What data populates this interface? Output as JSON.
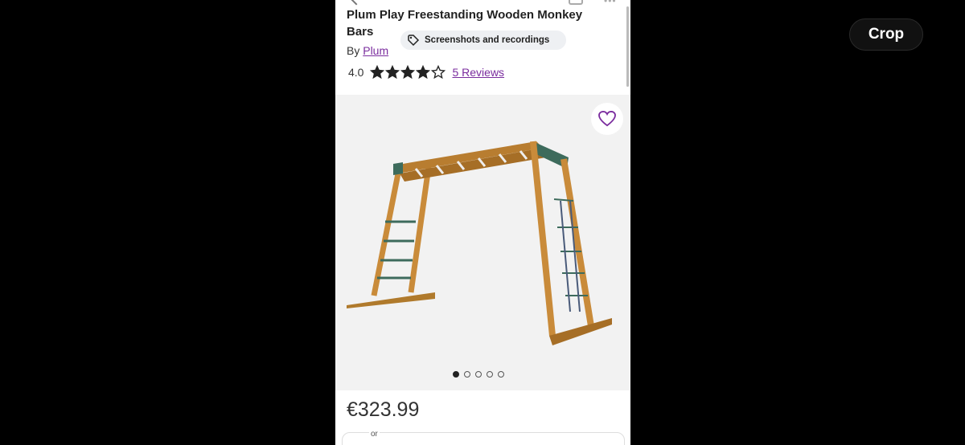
{
  "crop_button": {
    "label": "Crop"
  },
  "product": {
    "title": "Plum Play Freestanding Wooden Monkey Bars",
    "by_prefix": "By",
    "brand": "Plum",
    "rating": "4.0",
    "rating_value": 4,
    "rating_max": 5,
    "reviews_label": "5 Reviews",
    "price": "€323.99",
    "or_label": "or"
  },
  "screenshot_pill": {
    "label": "Screenshots and recordings",
    "icon": "tag-icon"
  },
  "gallery": {
    "image_count": 5,
    "active_index": 0,
    "favorite_icon": "heart-icon"
  },
  "colors": {
    "accent": "#7a2c9e",
    "background": "#000000"
  }
}
